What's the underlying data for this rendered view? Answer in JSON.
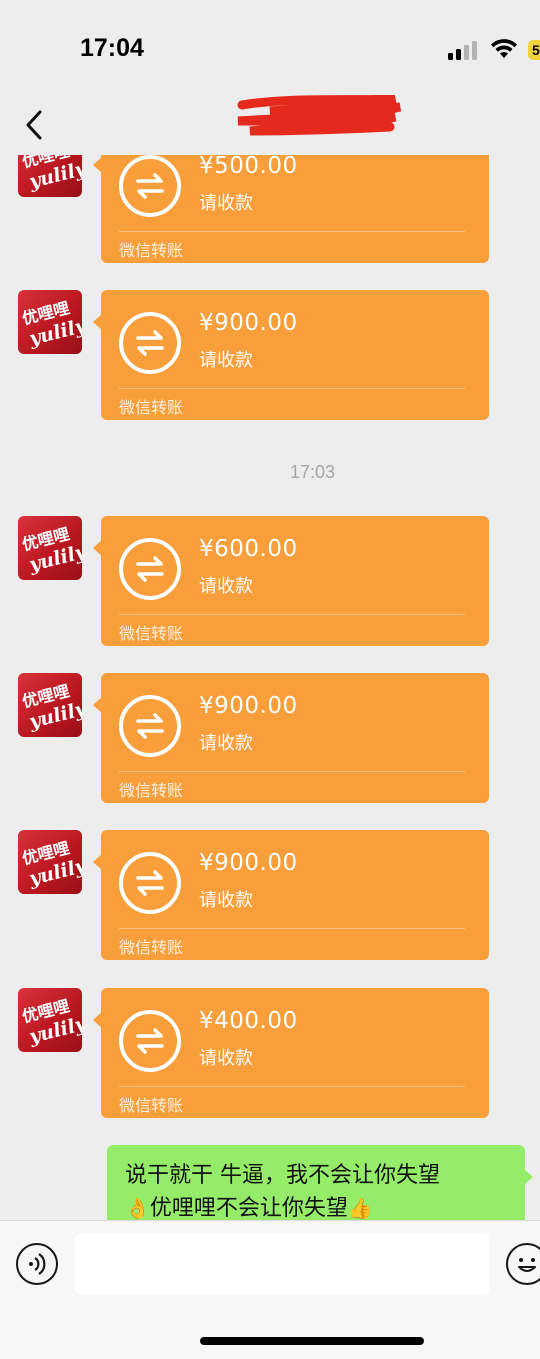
{
  "status_bar": {
    "time": "17:04",
    "battery": "5"
  },
  "header": {
    "title": "",
    "title_redacted": true
  },
  "messages": [
    {
      "type": "transfer",
      "amount": "¥500.00",
      "status": "请收款",
      "footer": "微信转账"
    },
    {
      "type": "transfer",
      "amount": "¥900.00",
      "status": "请收款",
      "footer": "微信转账"
    },
    {
      "type": "timestamp",
      "text": "17:03"
    },
    {
      "type": "transfer",
      "amount": "¥600.00",
      "status": "请收款",
      "footer": "微信转账"
    },
    {
      "type": "transfer",
      "amount": "¥900.00",
      "status": "请收款",
      "footer": "微信转账"
    },
    {
      "type": "transfer",
      "amount": "¥900.00",
      "status": "请收款",
      "footer": "微信转账"
    },
    {
      "type": "transfer",
      "amount": "¥400.00",
      "status": "请收款",
      "footer": "微信转账"
    },
    {
      "type": "text",
      "sender": "self",
      "line1": "说干就干  牛逼，我不会让你失望",
      "line2_emoji_start": "👌",
      "line2": "优哩哩不会让你失望",
      "line2_emoji_end": "👍"
    }
  ],
  "avatar": {
    "brand_cn": "优哩哩",
    "brand_en": "yulily"
  },
  "input_bar": {
    "text": "",
    "voice_icon": "voice-icon",
    "emoji_icon": "emoji-icon"
  },
  "colors": {
    "transfer_card": "#f89e3b",
    "sent_bubble": "#95ec69",
    "background": "#ededed",
    "avatar": "#c41e26"
  }
}
